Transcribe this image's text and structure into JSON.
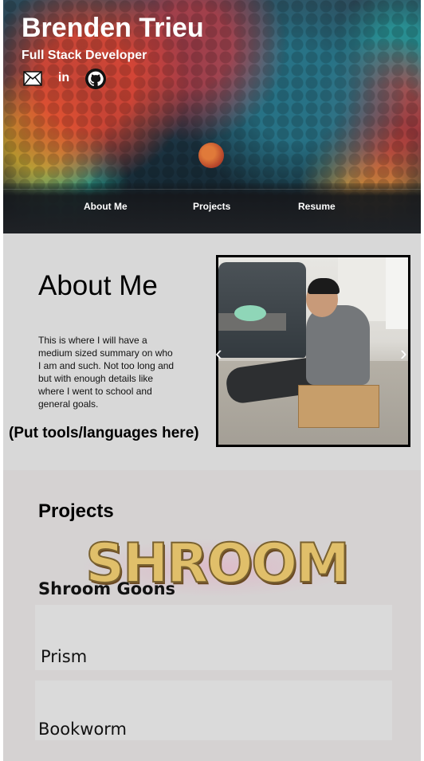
{
  "header": {
    "name": "Brenden Trieu",
    "role": "Full Stack Developer",
    "social": [
      {
        "icon": "mail-icon"
      },
      {
        "icon": "linkedin-icon",
        "glyph": "in"
      },
      {
        "icon": "github-icon"
      }
    ],
    "nav": [
      "About Me",
      "Projects",
      "Resume"
    ]
  },
  "about": {
    "title": "About Me",
    "summary": "This is where I will have a medium sized summary on who I am and such. Not too long and but with enough details like where I went to school and general goals.",
    "tools_placeholder": "(Put tools/languages here)",
    "carousel": {
      "prev_glyph": "‹",
      "next_glyph": "›"
    }
  },
  "projects": {
    "title": "Projects",
    "items": [
      {
        "name": "Shroom Goons",
        "logo_text": "SHROOM"
      },
      {
        "name": "Prism"
      },
      {
        "name": "Bookworm"
      }
    ]
  },
  "colors": {
    "section_about_bg": "#d8d8d8",
    "section_projects_bg": "#d5d2d2",
    "card_bg": "#dadada",
    "text_light": "#ffffff"
  }
}
